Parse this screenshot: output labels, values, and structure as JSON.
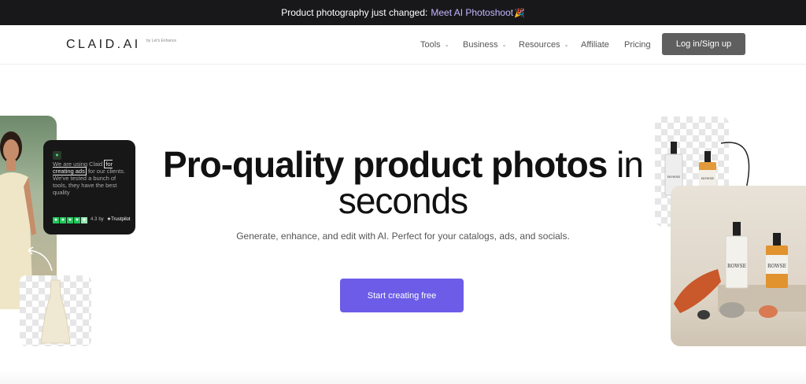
{
  "announcement": {
    "text": "Product photography just changed:",
    "link": "Meet AI Photoshoot",
    "emoji": "🎉"
  },
  "nav": {
    "logo": "CLAID.AI",
    "logo_sub": "by Let's Enhance",
    "items": [
      {
        "label": "Tools",
        "dropdown": true
      },
      {
        "label": "Business",
        "dropdown": true
      },
      {
        "label": "Resources",
        "dropdown": true
      },
      {
        "label": "Affiliate",
        "dropdown": false
      },
      {
        "label": "Pricing",
        "dropdown": false
      }
    ],
    "login_label": "Log in/Sign up"
  },
  "hero": {
    "headline_bold": "Pro-quality product photos",
    "headline_rest": "in",
    "headline_line2": "seconds",
    "subtitle": "Generate, enhance, and edit with AI. Perfect for your catalogs, ads, and socials.",
    "cta_label": "Start creating free"
  },
  "review": {
    "text_before": "We are using Claid",
    "highlight": "for creating ads",
    "text_after": "for our clients. We've tested a bunch of tools, they have the best quality",
    "rating": "4.3",
    "by": "by",
    "platform": "Trustpilot"
  },
  "product": {
    "brand": "ROWSE"
  },
  "colors": {
    "announcement_bg": "#18181b",
    "link": "#c4b5fd",
    "cta": "#6c5ce7",
    "login_bg": "#5f5f5f",
    "star": "#22c55e"
  }
}
